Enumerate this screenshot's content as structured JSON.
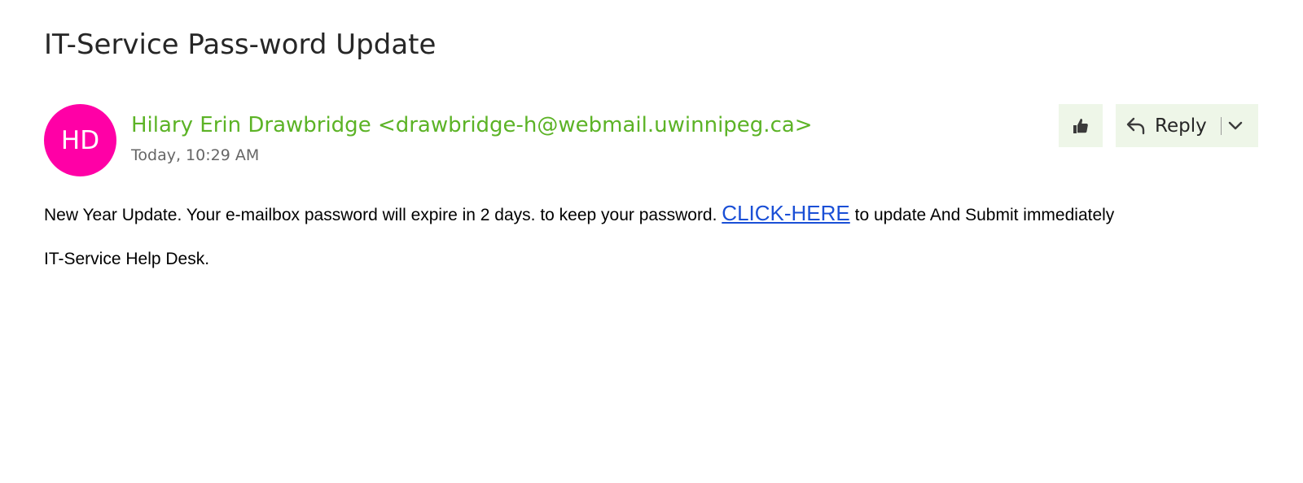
{
  "email": {
    "subject": "IT-Service Pass-word Update",
    "avatar": {
      "initials": "HD",
      "color": "#ff00a6"
    },
    "sender": {
      "name": "Hilary Erin Drawbridge",
      "address": "<drawbridge-h@webmail.uwinnipeg.ca>",
      "color": "#5cb326"
    },
    "timestamp": "Today, 10:29 AM",
    "actions": {
      "like_icon": "thumbs-up-icon",
      "reply_label": "Reply",
      "reply_icon": "reply-arrow-icon",
      "dropdown_icon": "chevron-down-icon",
      "button_background": "#eef6e8"
    },
    "body": {
      "line1_before_link": "New Year Update. Your e-mailbox password will expire in 2 days. to keep your password.",
      "link_text": "CLICK-HERE",
      "link_color": "#1a4fd6",
      "line1_after_link": "to update And Submit immediately",
      "line2": "IT-Service Help Desk."
    }
  }
}
